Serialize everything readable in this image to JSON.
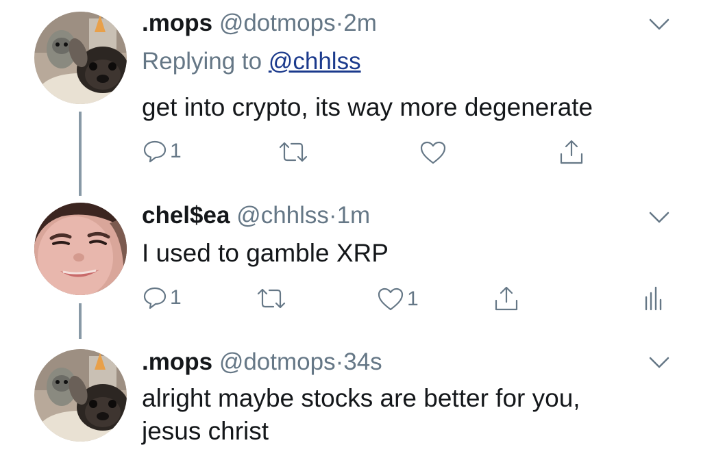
{
  "tweets": [
    {
      "display_name": ".mops",
      "handle": "@dotmops",
      "separator": "·",
      "time": "2m",
      "replying_prefix": "Replying to",
      "replying_to": "@chhlss",
      "text": "get into crypto, its way more degenerate",
      "reply_count": "1",
      "retweet_count": "",
      "like_count": ""
    },
    {
      "display_name": "chel$ea",
      "handle": "@chhlss",
      "separator": "·",
      "time": "1m",
      "text": "I used to gamble XRP",
      "reply_count": "1",
      "retweet_count": "",
      "like_count": "1"
    },
    {
      "display_name": ".mops",
      "handle": "@dotmops",
      "separator": "·",
      "time": "34s",
      "text_line1": "alright maybe stocks are better for you,",
      "text_line2": "jesus christ"
    }
  ],
  "icons": {
    "reply": "reply-icon",
    "retweet": "retweet-icon",
    "like": "heart-icon",
    "share": "share-icon",
    "analytics": "analytics-icon",
    "more": "chevron-down-icon"
  },
  "colors": {
    "text_primary": "#14171a",
    "text_secondary": "#657786",
    "link": "#1b3a8c",
    "thread_line": "#8899a6"
  }
}
